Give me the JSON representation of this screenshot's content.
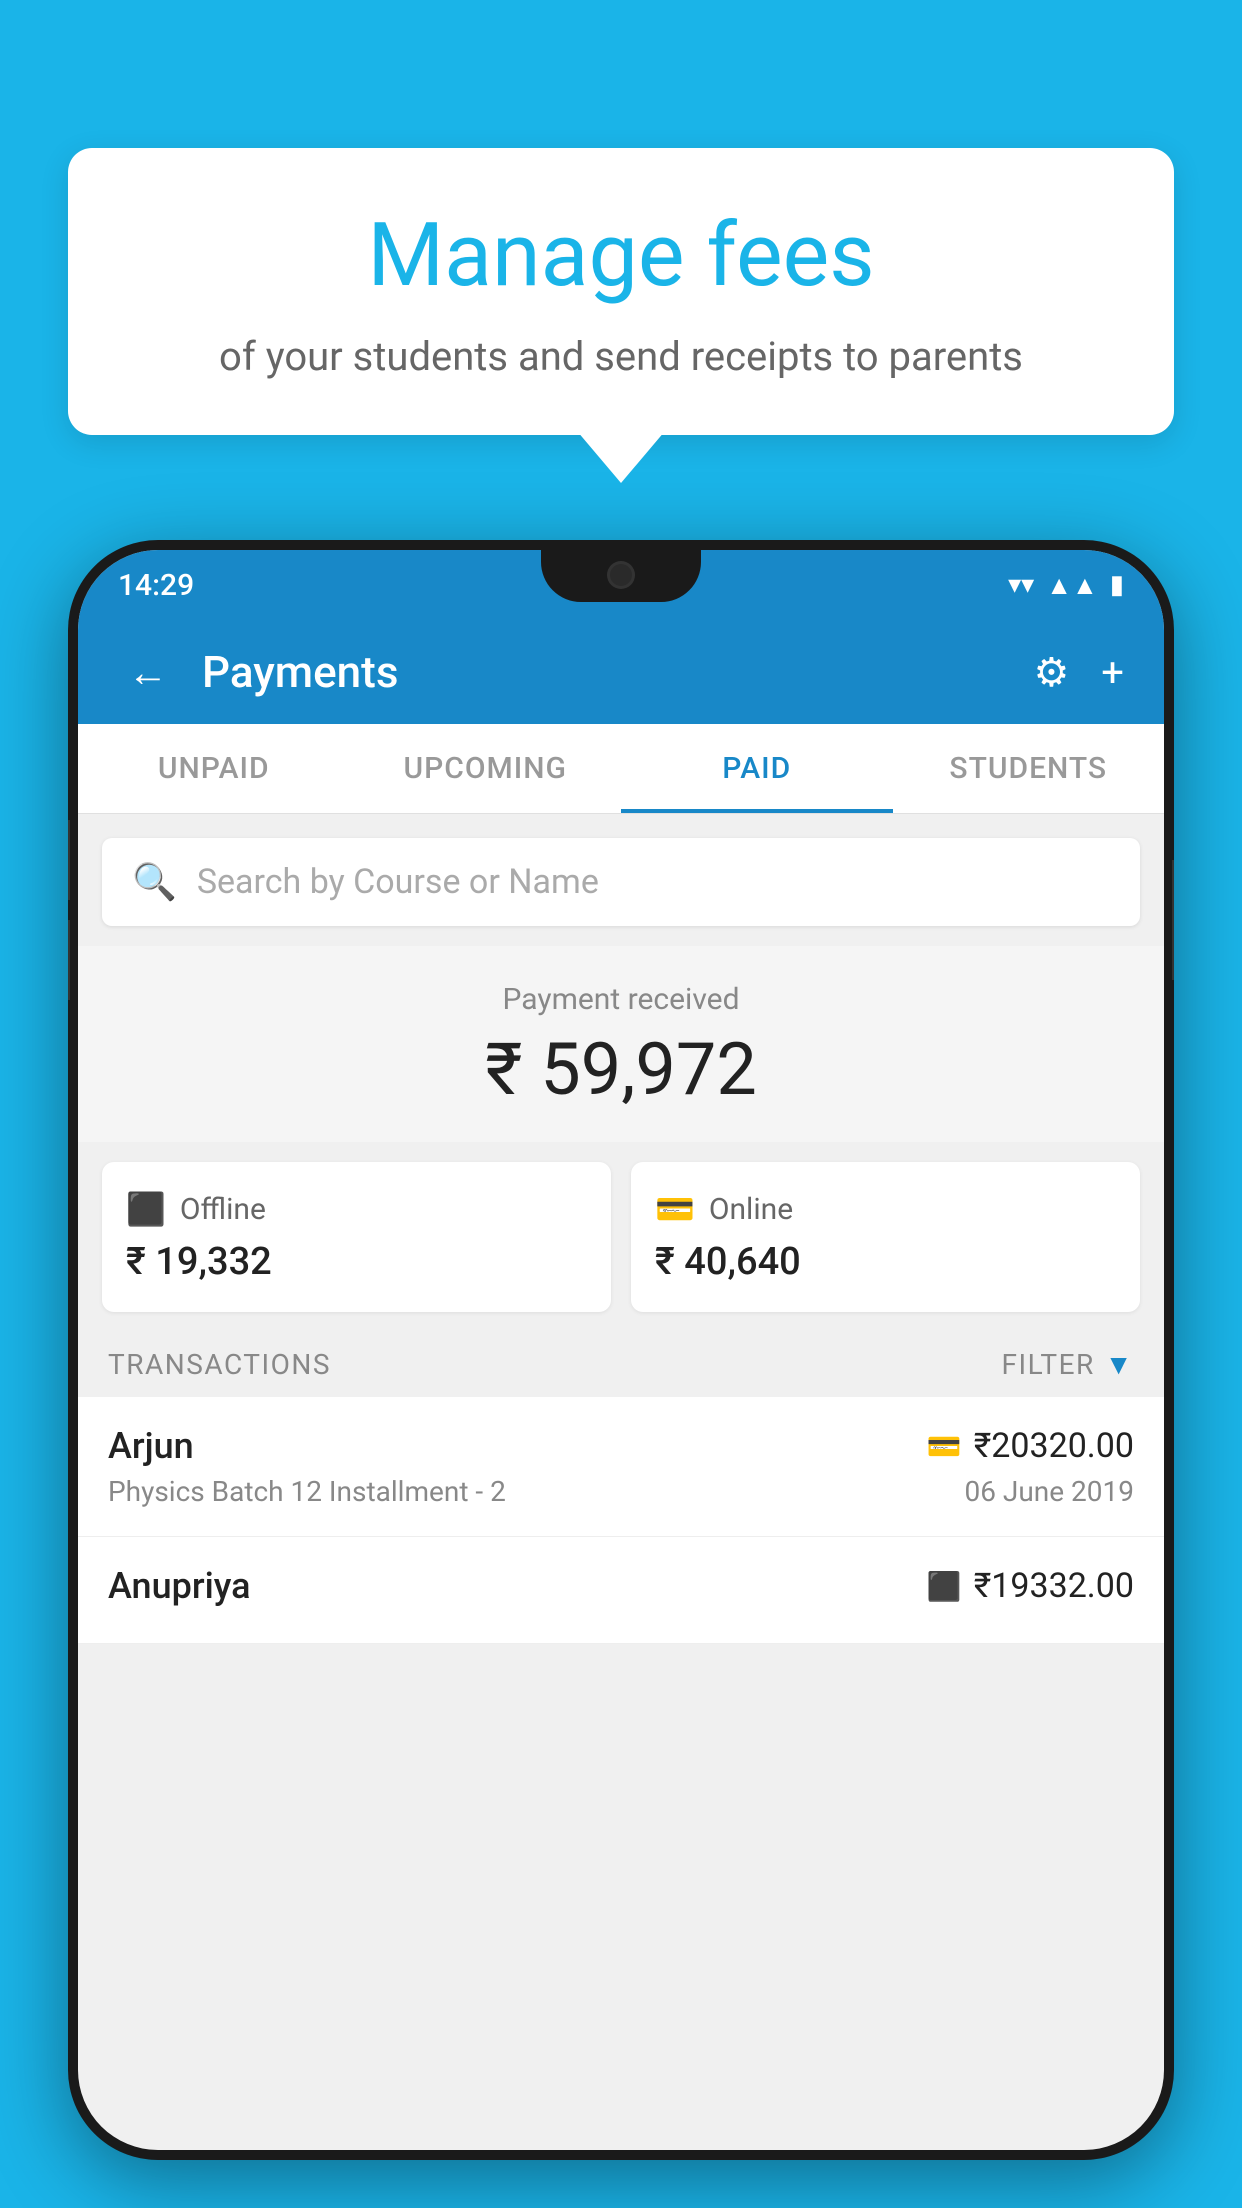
{
  "background_color": "#1ab4e8",
  "tooltip": {
    "title": "Manage fees",
    "subtitle": "of your students and send receipts to parents"
  },
  "status_bar": {
    "time": "14:29",
    "icons": [
      "wifi",
      "signal",
      "battery"
    ]
  },
  "header": {
    "title": "Payments",
    "back_label": "←",
    "settings_label": "⚙",
    "add_label": "+"
  },
  "tabs": [
    {
      "label": "UNPAID",
      "active": false
    },
    {
      "label": "UPCOMING",
      "active": false
    },
    {
      "label": "PAID",
      "active": true
    },
    {
      "label": "STUDENTS",
      "active": false
    }
  ],
  "search": {
    "placeholder": "Search by Course or Name"
  },
  "payment_received": {
    "label": "Payment received",
    "amount": "₹ 59,972"
  },
  "payment_methods": [
    {
      "type": "Offline",
      "icon": "offline",
      "amount": "₹ 19,332"
    },
    {
      "type": "Online",
      "icon": "online",
      "amount": "₹ 40,640"
    }
  ],
  "transactions_header": {
    "label": "TRANSACTIONS",
    "filter_label": "FILTER"
  },
  "transactions": [
    {
      "name": "Arjun",
      "course": "Physics Batch 12 Installment - 2",
      "amount": "₹20320.00",
      "date": "06 June 2019",
      "method": "online"
    },
    {
      "name": "Anupriya",
      "course": "",
      "amount": "₹19332.00",
      "date": "",
      "method": "offline"
    }
  ]
}
